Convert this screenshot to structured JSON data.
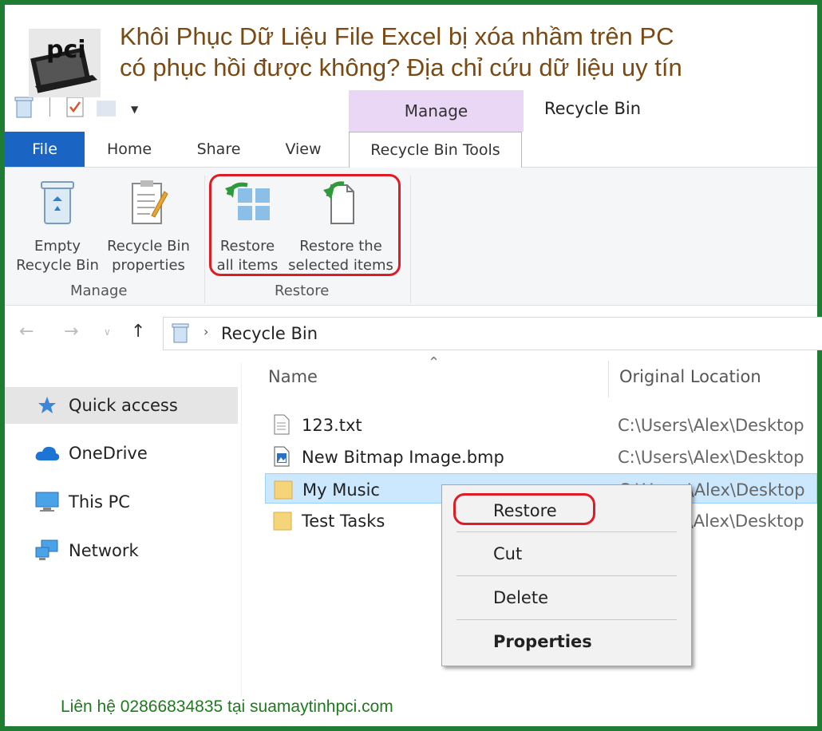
{
  "banner": {
    "title": "Khôi Phục Dữ Liệu File Excel bị xóa nhầm trên PC có phục hồi được không? Địa chỉ cứu dữ liệu uy tín",
    "logo_text": "pci",
    "footer": "Liên hệ 02866834835 tại suamaytinhpci.com"
  },
  "window": {
    "title": "Recycle Bin",
    "contextual_tab": "Manage"
  },
  "tabs": [
    "File",
    "Home",
    "Share",
    "View",
    "Recycle Bin Tools"
  ],
  "ribbon": {
    "manage_group": {
      "label": "Manage",
      "empty": "Empty\nRecycle Bin",
      "properties": "Recycle Bin\nproperties"
    },
    "restore_group": {
      "label": "Restore",
      "restore_all": "Restore\nall items",
      "restore_selected": "Restore the\nselected items"
    }
  },
  "address": {
    "location": "Recycle Bin"
  },
  "sidebar": {
    "items": [
      "Quick access",
      "OneDrive",
      "This PC",
      "Network"
    ]
  },
  "file_list": {
    "columns": [
      "Name",
      "Original Location"
    ],
    "rows": [
      {
        "name": "123.txt",
        "location": "C:\\Users\\Alex\\Desktop",
        "icon": "text-file-icon"
      },
      {
        "name": "New Bitmap Image.bmp",
        "location": "C:\\Users\\Alex\\Desktop",
        "icon": "bitmap-file-icon"
      },
      {
        "name": "My Music",
        "location": "C:\\Users\\Alex\\Desktop",
        "icon": "folder-icon",
        "selected": true
      },
      {
        "name": "Test Tasks",
        "location": "C:\\Users\\Alex\\Desktop",
        "icon": "folder-icon"
      }
    ]
  },
  "context_menu": {
    "items": [
      "Restore",
      "Cut",
      "Delete",
      "Properties"
    ]
  },
  "colors": {
    "frame": "#1e7d32",
    "highlight": "#e01b24",
    "file_tab": "#1a65c4",
    "selection": "#cce8ff"
  }
}
